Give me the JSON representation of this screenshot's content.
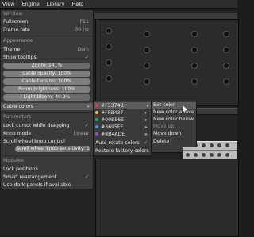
{
  "menubar": {
    "items": [
      "View",
      "Engine",
      "Library",
      "Help"
    ]
  },
  "view_menu": {
    "window_header": "Window",
    "fullscreen": {
      "label": "Fullscreen",
      "shortcut": "F11"
    },
    "frame_rate": {
      "label": "Frame rate",
      "value": "30 Hz"
    },
    "appearance_header": "Appearance",
    "theme": {
      "label": "Theme",
      "value": "Dark"
    },
    "show_tooltips": {
      "label": "Show tooltips",
      "check": "✓"
    },
    "sliders": [
      {
        "label": "Zoom: 141%",
        "fraction": 0.55
      },
      {
        "label": "Cable opacity: 100%",
        "fraction": 1.0
      },
      {
        "label": "Cable tension: 100%",
        "fraction": 1.0
      },
      {
        "label": "Room brightness: 100%",
        "fraction": 1.0
      },
      {
        "label": "Light bloom: 49.9%",
        "fraction": 0.5
      }
    ],
    "cable_colors": {
      "label": "Cable colors",
      "arrow": "▸"
    },
    "parameters_header": "Parameters",
    "lock_cursor": {
      "label": "Lock cursor while dragging",
      "check": "✓"
    },
    "knob_mode": {
      "label": "Knob mode",
      "value": "Linear"
    },
    "scroll_wheel": {
      "label": "Scroll wheel knob control"
    },
    "scroll_sensitivity": {
      "label": "Scroll wheel knob sensitivity: 1",
      "fraction": 0.62
    },
    "modules_header": "Modules",
    "lock_positions": {
      "label": "Lock positions"
    },
    "smart_rearrangement": {
      "label": "Smart rearrangement",
      "check": "✓"
    },
    "dark_panels": {
      "label": "Use dark panels if available"
    }
  },
  "cable_colors_menu": {
    "colors": [
      {
        "hex_label": "#F3374B",
        "color": "#F3374B",
        "arrow": "▸"
      },
      {
        "hex_label": "#FFB437",
        "color": "#FFB437",
        "arrow": "▸"
      },
      {
        "hex_label": "#00B56E",
        "color": "#00B56E",
        "arrow": "▸"
      },
      {
        "hex_label": "#3695EF",
        "color": "#3695EF",
        "arrow": "▸"
      },
      {
        "hex_label": "#8B4ADE",
        "color": "#8B4ADE",
        "arrow": "▸"
      }
    ],
    "auto_rotate": {
      "label": "Auto-rotate colors",
      "check": "✓"
    },
    "restore_factory": {
      "label": "Restore factory colors"
    }
  },
  "color_actions": {
    "items": [
      "Set color",
      "New color above",
      "New color below",
      "Move up",
      "Move down",
      "Delete"
    ]
  }
}
